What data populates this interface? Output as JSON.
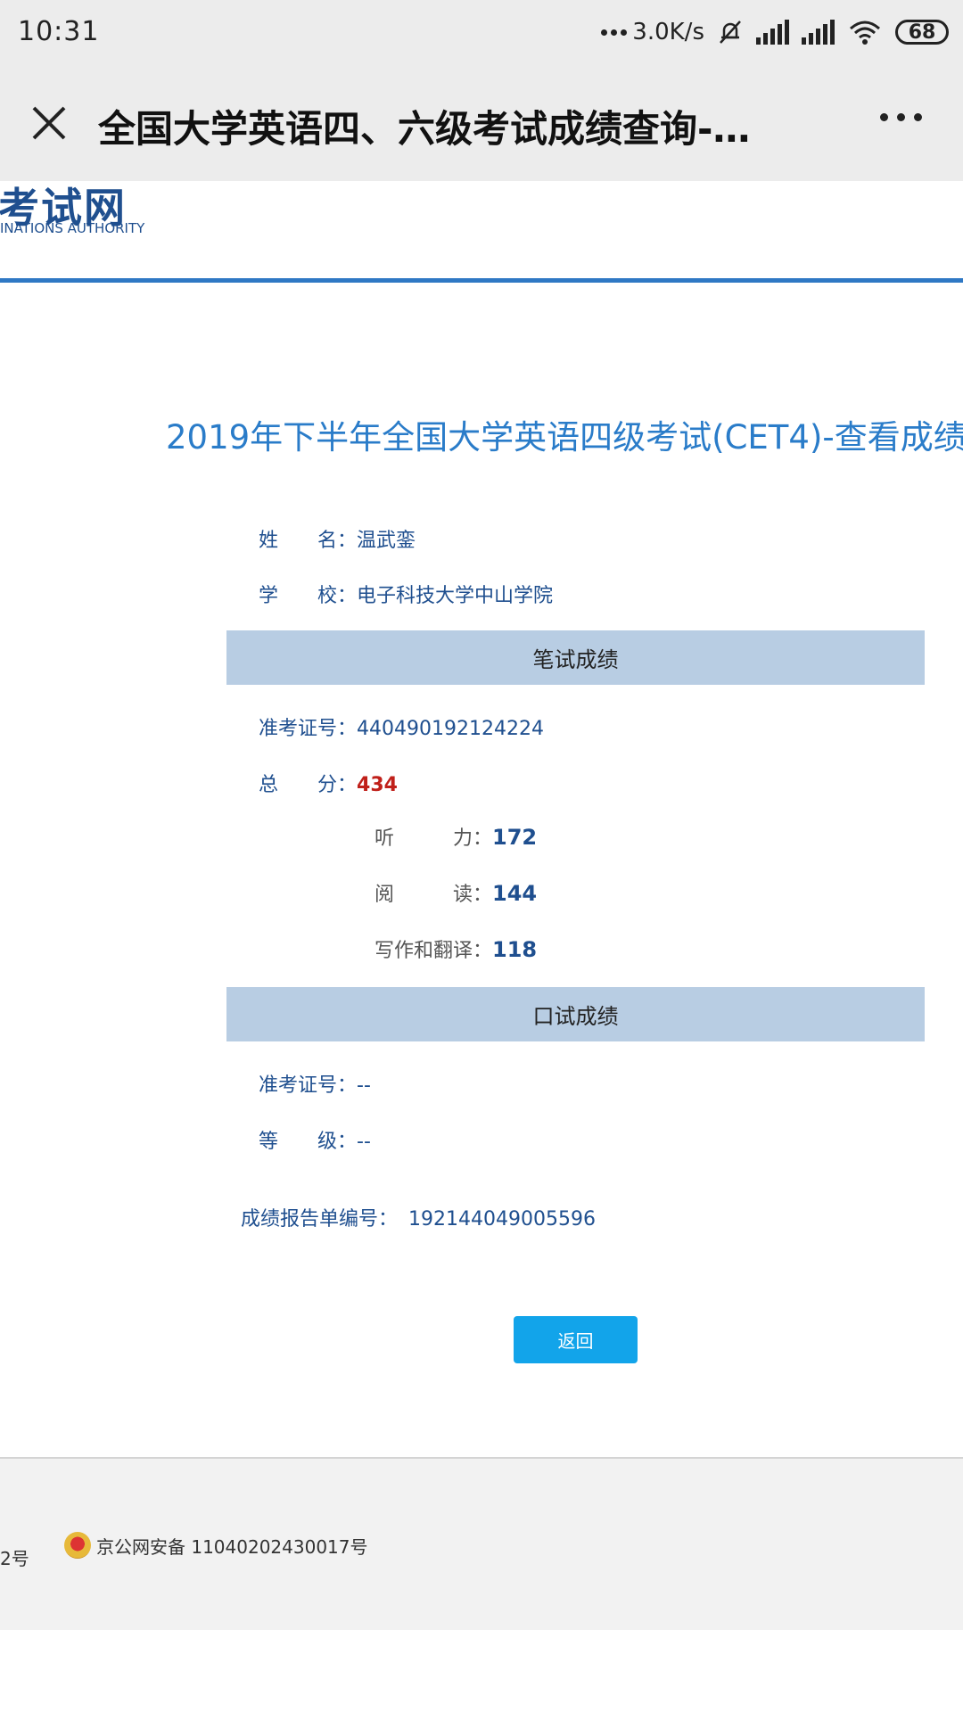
{
  "status_bar": {
    "time": "10:31",
    "net_speed": "3.0K/s",
    "battery": "68"
  },
  "app_bar": {
    "title": "全国大学英语四、六级考试成绩查询-…"
  },
  "site": {
    "logo_text": "考试网",
    "logo_sub": "INATIONS AUTHORITY"
  },
  "page": {
    "title": "2019年下半年全国大学英语四级考试(CET4)-查看成绩"
  },
  "candidate": {
    "name_label": "姓　　名：",
    "name_value": "温武銮",
    "school_label": "学　　校：",
    "school_value": "电子科技大学中山学院"
  },
  "written": {
    "section_title": "笔试成绩",
    "ticket_label": "准考证号：",
    "ticket_value": "440490192124224",
    "total_label": "总　　分：",
    "total_value": "434",
    "listening_label": "听　　　力：",
    "listening_value": "172",
    "reading_label": "阅　　　读：",
    "reading_value": "144",
    "writing_label": "写作和翻译：",
    "writing_value": "118"
  },
  "oral": {
    "section_title": "口试成绩",
    "ticket_label": "准考证号：",
    "ticket_value": "--",
    "grade_label": "等　　级：",
    "grade_value": "--"
  },
  "report": {
    "label": "成绩报告单编号：",
    "value": "192144049005596"
  },
  "return_button": "返回",
  "footer": {
    "left_text": "2号",
    "icp_text": "京公网安备 11040202430017号"
  },
  "colors": {
    "accent_blue": "#2f78c4",
    "section_bg": "#b8cde3",
    "button_bg": "#12a4ea",
    "total_red": "#c0201a"
  }
}
